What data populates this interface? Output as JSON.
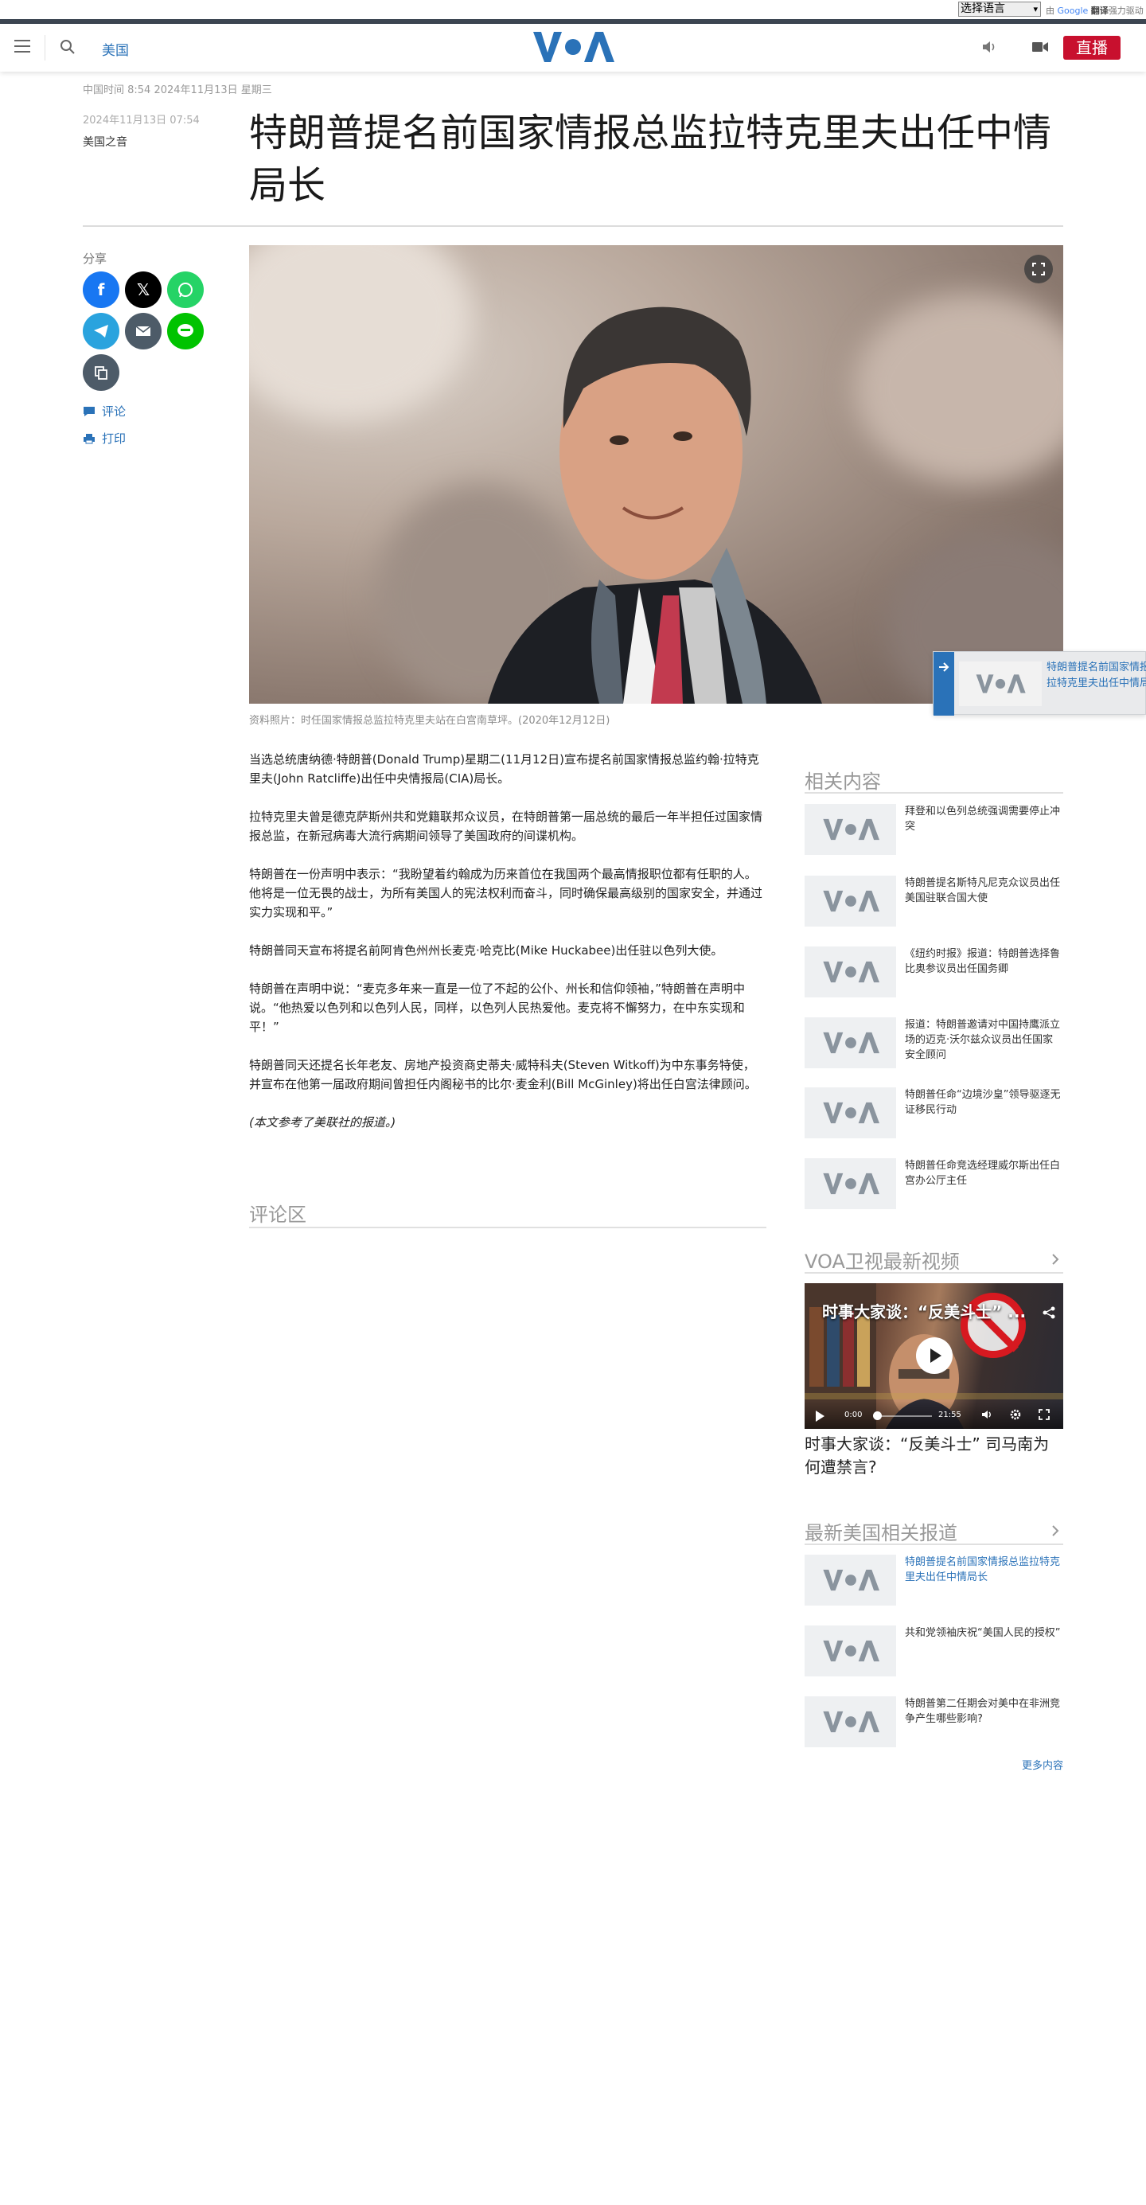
{
  "translate": {
    "select_label": "选择语言",
    "credit_by": "由",
    "credit_google": "Google",
    "credit_translate": "翻译",
    "credit_powered": "强力驱动"
  },
  "header": {
    "section": "美国",
    "live_label": "直播",
    "logo_text": "VOA"
  },
  "article": {
    "datetime_line": "中国时间 8:54 2024年11月13日 星期三",
    "pub_date": "2024年11月13日 07:54",
    "author": "美国之音",
    "headline": "特朗普提名前国家情报总监拉特克里夫出任中情局长",
    "caption": "资料照片：时任国家情报总监拉特克里夫站在白宫南草坪。(2020年12月12日)",
    "paragraphs": [
      "当选总统唐纳德·特朗普(Donald Trump)星期二(11月12日)宣布提名前国家情报总监约翰·拉特克里夫(John Ratcliffe)出任中央情报局(CIA)局长。",
      "拉特克里夫曾是德克萨斯州共和党籍联邦众议员，在特朗普第一届总统的最后一年半担任过国家情报总监，在新冠病毒大流行病期间领导了美国政府的间谍机构。",
      "特朗普在一份声明中表示：“我盼望着约翰成为历来首位在我国两个最高情报职位都有任职的人。他将是一位无畏的战士，为所有美国人的宪法权利而奋斗，同时确保最高级别的国家安全，并通过实力实现和平。”",
      "特朗普同天宣布将提名前阿肯色州州长麦克·哈克比(Mike Huckabee)出任驻以色列大使。",
      "特朗普在声明中说：“麦克多年来一直是一位了不起的公仆、州长和信仰领袖，”特朗普在声明中说。“他热爱以色列和以色列人民，同样，以色列人民热爱他。麦克将不懈努力，在中东实现和平！”",
      "特朗普同天还提名长年老友、房地产投资商史蒂夫·威特科夫(Steven Witkoff)为中东事务特使，并宣布在他第一届政府期间曾担任内阁秘书的比尔·麦金利(Bill McGinley)将出任白宫法律顾问。"
    ],
    "note": "(本文参考了美联社的报道。)",
    "comments_title": "评论区"
  },
  "share": {
    "label": "分享",
    "comment_label": "评论",
    "print_label": "打印",
    "colors": {
      "facebook": "#1877f2",
      "x": "#000000",
      "whatsapp": "#25d366",
      "telegram": "#2aa3de",
      "email": "#4d5b68",
      "line": "#00c300",
      "copy": "#4d5b68"
    }
  },
  "mini_player": {
    "text_line1": "特朗普提名前国家情报总监拉",
    "text_line2": "拉特克里夫出任中情局长"
  },
  "related": {
    "title": "相关内容",
    "items": [
      "拜登和以色列总统强调需要停止冲突",
      "特朗普提名斯特凡尼克众议员出任美国驻联合国大使",
      "《纽约时报》报道：特朗普选择鲁比奥参议员出任国务卿",
      "报道：特朗普邀请对中国持鹰派立场的迈克·沃尔兹众议员出任国家安全顾问",
      "特朗普任命“边境沙皇”领导驱逐无证移民行动",
      "特朗普任命竞选经理威尔斯出任白宫办公厅主任"
    ]
  },
  "video": {
    "section_title": "VOA卫视最新视频",
    "overlay_title": "时事大家谈：“反美斗士” ...",
    "current_time": "0:00",
    "duration": "21:55",
    "caption": "时事大家谈：“反美斗士” 司马南为何遭禁言?"
  },
  "latest": {
    "title": "最新美国相关报道",
    "items": [
      "特朗普提名前国家情报总监拉特克里夫出任中情局长",
      "共和党领袖庆祝“美国人民的授权”",
      "特朗普第二任期会对美中在非洲竞争产生哪些影响?"
    ],
    "more_label": "更多内容"
  },
  "colors": {
    "accent": "#2a72b8",
    "live": "#c8102e",
    "voa_blue": "#2a72b8"
  }
}
